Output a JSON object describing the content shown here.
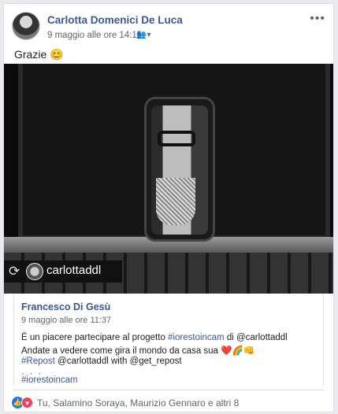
{
  "post": {
    "author": "Carlotta Domenici De Luca",
    "date": "9 maggio alle ore 14:15 ·",
    "audience_icon": "friends-icon",
    "more_icon": "more-options-icon",
    "more_glyph": "•••",
    "text": "Grazie 😊"
  },
  "photo": {
    "repost_icon": "repost-icon",
    "repost_glyph": "⟳",
    "repost_username": "carlottaddl"
  },
  "shared": {
    "author": "Francesco Di Gesù",
    "date": "9 maggio alle ore 11:37",
    "line1_prefix": "È un piacere partecipare al progetto ",
    "line1_tag": "#iorestoincam",
    "line1_suffix": " di @carlottaddl",
    "line2": "Andate a vedere come gira il mondo da casa sua ❤️🌈👊",
    "line3_tag": "#Repost",
    "line3_suffix": " @carlottaddl with @get_repost",
    "ellipsis": "· · ·",
    "line4_tag": "#iorestoincam"
  },
  "reactions": {
    "like_icon": "like-reaction-icon",
    "love_icon": "love-reaction-icon",
    "text": "Tu, Salamino Soraya, Maurizio Gennaro e altri 8"
  }
}
